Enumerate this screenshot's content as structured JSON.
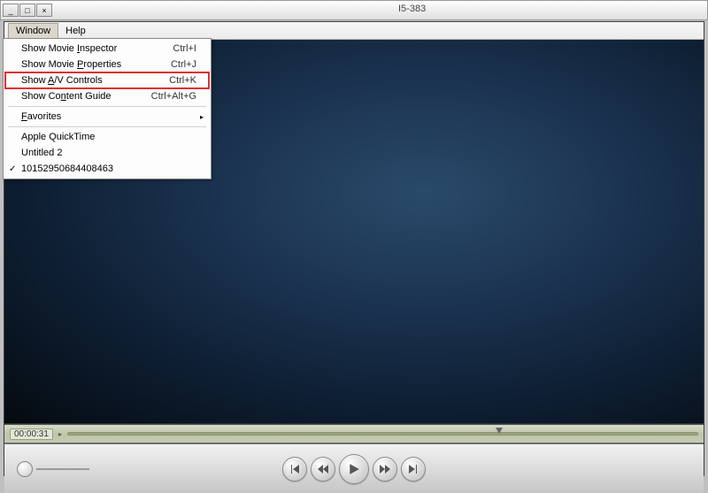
{
  "title_bar": {
    "fragment": "I5-383"
  },
  "menubar": {
    "items": [
      "Window",
      "Help"
    ],
    "active_index": 0
  },
  "window_menu": {
    "items": [
      {
        "label": "Show Movie Inspector",
        "accel": "Ctrl+I",
        "underline_idx": 11
      },
      {
        "label": "Show Movie Properties",
        "accel": "Ctrl+J",
        "underline_idx": 11
      },
      {
        "label": "Show A/V Controls",
        "accel": "Ctrl+K",
        "highlighted": true,
        "underline_idx": 5
      },
      {
        "label": "Show Content Guide",
        "accel": "Ctrl+Alt+G",
        "underline_idx": 7
      },
      {
        "sep": true
      },
      {
        "label": "Favorites",
        "submenu": true,
        "underline_idx": 0
      },
      {
        "sep": true
      },
      {
        "label": "Apple QuickTime"
      },
      {
        "label": "Untitled 2"
      },
      {
        "label": "10152950684408463",
        "checked": true
      }
    ]
  },
  "player": {
    "time_display": "00:00:31"
  }
}
